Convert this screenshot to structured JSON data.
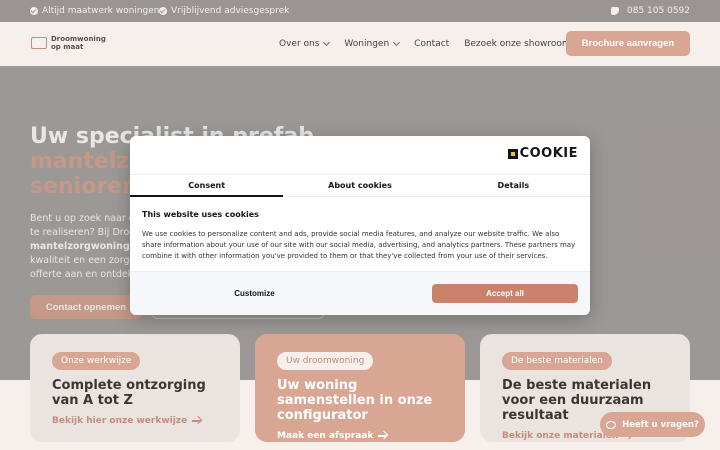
{
  "topbar": {
    "usp1": "Altijd maatwerk woningen",
    "usp2": "Vrijblijvend adviesgesprek",
    "phone": "085 105 0592"
  },
  "header": {
    "logo_line1": "Droomwoning",
    "logo_line2": "op maat",
    "nav": [
      "Over ons",
      "Woningen",
      "Contact",
      "Bezoek onze showroom"
    ],
    "brochure_label": "Brochure aanvragen"
  },
  "hero": {
    "title_line1": "Uw specialist in prefab",
    "title_line2": "mantelzorgwoningen",
    "title_line3": "seniorenwoningen",
    "text_a": "Bent u op zoek naar een",
    "text_b": "te realiseren? Bij Droom",
    "text_c_bold": "mantelzorgwoningen",
    "text_d": "kwaliteit en een zorgele",
    "text_e": "offerte aan en ontdek",
    "contact_label": "Contact opnemen"
  },
  "cards": [
    {
      "tag": "Onze werkwijze",
      "title": "Complete ontzorging van A tot Z",
      "link": "Bekijk hier onze werkwijze"
    },
    {
      "tag": "Uw droomwoning",
      "title": "Uw woning samenstellen in onze configurator",
      "link": "Maak een afspraak"
    },
    {
      "tag": "De beste materialen",
      "title": "De beste materialen voor een duurzaam resultaat",
      "link": "Bekijk onze materialen"
    }
  ],
  "cookie": {
    "logo": "COOKIE",
    "tabs": [
      "Consent",
      "About cookies",
      "Details"
    ],
    "heading": "This website uses cookies",
    "body": "We use cookies to personalize content and ads, provide social media features, and analyze our website traffic. We also share information about your use of our site with our social media, advertising, and analytics partners. These partners may combine it with other information you've provided to them or that they've collected from your use of their services.",
    "customize_label": "Customize",
    "accept_label": "Accept all"
  },
  "chat": {
    "label": "Heeft u vragen?"
  },
  "colors": {
    "accent": "#d9a694",
    "accept": "#c9836a",
    "topbar": "#9a9593"
  }
}
